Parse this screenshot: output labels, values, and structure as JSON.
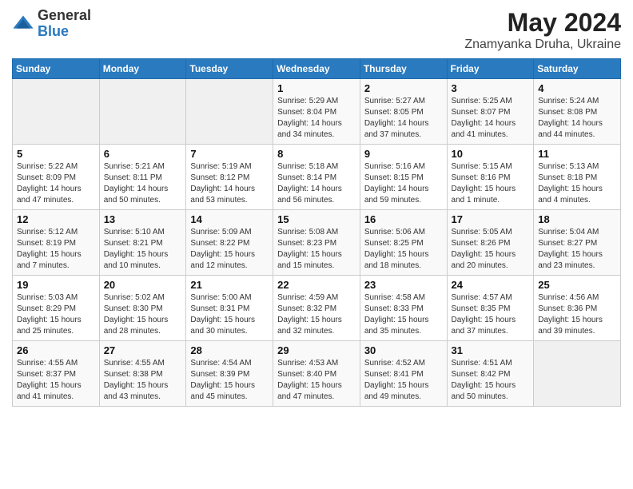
{
  "header": {
    "logo_general": "General",
    "logo_blue": "Blue",
    "title": "May 2024",
    "subtitle": "Znamyanka Druha, Ukraine"
  },
  "weekdays": [
    "Sunday",
    "Monday",
    "Tuesday",
    "Wednesday",
    "Thursday",
    "Friday",
    "Saturday"
  ],
  "weeks": [
    [
      {
        "day": "",
        "info": ""
      },
      {
        "day": "",
        "info": ""
      },
      {
        "day": "",
        "info": ""
      },
      {
        "day": "1",
        "info": "Sunrise: 5:29 AM\nSunset: 8:04 PM\nDaylight: 14 hours\nand 34 minutes."
      },
      {
        "day": "2",
        "info": "Sunrise: 5:27 AM\nSunset: 8:05 PM\nDaylight: 14 hours\nand 37 minutes."
      },
      {
        "day": "3",
        "info": "Sunrise: 5:25 AM\nSunset: 8:07 PM\nDaylight: 14 hours\nand 41 minutes."
      },
      {
        "day": "4",
        "info": "Sunrise: 5:24 AM\nSunset: 8:08 PM\nDaylight: 14 hours\nand 44 minutes."
      }
    ],
    [
      {
        "day": "5",
        "info": "Sunrise: 5:22 AM\nSunset: 8:09 PM\nDaylight: 14 hours\nand 47 minutes."
      },
      {
        "day": "6",
        "info": "Sunrise: 5:21 AM\nSunset: 8:11 PM\nDaylight: 14 hours\nand 50 minutes."
      },
      {
        "day": "7",
        "info": "Sunrise: 5:19 AM\nSunset: 8:12 PM\nDaylight: 14 hours\nand 53 minutes."
      },
      {
        "day": "8",
        "info": "Sunrise: 5:18 AM\nSunset: 8:14 PM\nDaylight: 14 hours\nand 56 minutes."
      },
      {
        "day": "9",
        "info": "Sunrise: 5:16 AM\nSunset: 8:15 PM\nDaylight: 14 hours\nand 59 minutes."
      },
      {
        "day": "10",
        "info": "Sunrise: 5:15 AM\nSunset: 8:16 PM\nDaylight: 15 hours\nand 1 minute."
      },
      {
        "day": "11",
        "info": "Sunrise: 5:13 AM\nSunset: 8:18 PM\nDaylight: 15 hours\nand 4 minutes."
      }
    ],
    [
      {
        "day": "12",
        "info": "Sunrise: 5:12 AM\nSunset: 8:19 PM\nDaylight: 15 hours\nand 7 minutes."
      },
      {
        "day": "13",
        "info": "Sunrise: 5:10 AM\nSunset: 8:21 PM\nDaylight: 15 hours\nand 10 minutes."
      },
      {
        "day": "14",
        "info": "Sunrise: 5:09 AM\nSunset: 8:22 PM\nDaylight: 15 hours\nand 12 minutes."
      },
      {
        "day": "15",
        "info": "Sunrise: 5:08 AM\nSunset: 8:23 PM\nDaylight: 15 hours\nand 15 minutes."
      },
      {
        "day": "16",
        "info": "Sunrise: 5:06 AM\nSunset: 8:25 PM\nDaylight: 15 hours\nand 18 minutes."
      },
      {
        "day": "17",
        "info": "Sunrise: 5:05 AM\nSunset: 8:26 PM\nDaylight: 15 hours\nand 20 minutes."
      },
      {
        "day": "18",
        "info": "Sunrise: 5:04 AM\nSunset: 8:27 PM\nDaylight: 15 hours\nand 23 minutes."
      }
    ],
    [
      {
        "day": "19",
        "info": "Sunrise: 5:03 AM\nSunset: 8:29 PM\nDaylight: 15 hours\nand 25 minutes."
      },
      {
        "day": "20",
        "info": "Sunrise: 5:02 AM\nSunset: 8:30 PM\nDaylight: 15 hours\nand 28 minutes."
      },
      {
        "day": "21",
        "info": "Sunrise: 5:00 AM\nSunset: 8:31 PM\nDaylight: 15 hours\nand 30 minutes."
      },
      {
        "day": "22",
        "info": "Sunrise: 4:59 AM\nSunset: 8:32 PM\nDaylight: 15 hours\nand 32 minutes."
      },
      {
        "day": "23",
        "info": "Sunrise: 4:58 AM\nSunset: 8:33 PM\nDaylight: 15 hours\nand 35 minutes."
      },
      {
        "day": "24",
        "info": "Sunrise: 4:57 AM\nSunset: 8:35 PM\nDaylight: 15 hours\nand 37 minutes."
      },
      {
        "day": "25",
        "info": "Sunrise: 4:56 AM\nSunset: 8:36 PM\nDaylight: 15 hours\nand 39 minutes."
      }
    ],
    [
      {
        "day": "26",
        "info": "Sunrise: 4:55 AM\nSunset: 8:37 PM\nDaylight: 15 hours\nand 41 minutes."
      },
      {
        "day": "27",
        "info": "Sunrise: 4:55 AM\nSunset: 8:38 PM\nDaylight: 15 hours\nand 43 minutes."
      },
      {
        "day": "28",
        "info": "Sunrise: 4:54 AM\nSunset: 8:39 PM\nDaylight: 15 hours\nand 45 minutes."
      },
      {
        "day": "29",
        "info": "Sunrise: 4:53 AM\nSunset: 8:40 PM\nDaylight: 15 hours\nand 47 minutes."
      },
      {
        "day": "30",
        "info": "Sunrise: 4:52 AM\nSunset: 8:41 PM\nDaylight: 15 hours\nand 49 minutes."
      },
      {
        "day": "31",
        "info": "Sunrise: 4:51 AM\nSunset: 8:42 PM\nDaylight: 15 hours\nand 50 minutes."
      },
      {
        "day": "",
        "info": ""
      }
    ]
  ]
}
